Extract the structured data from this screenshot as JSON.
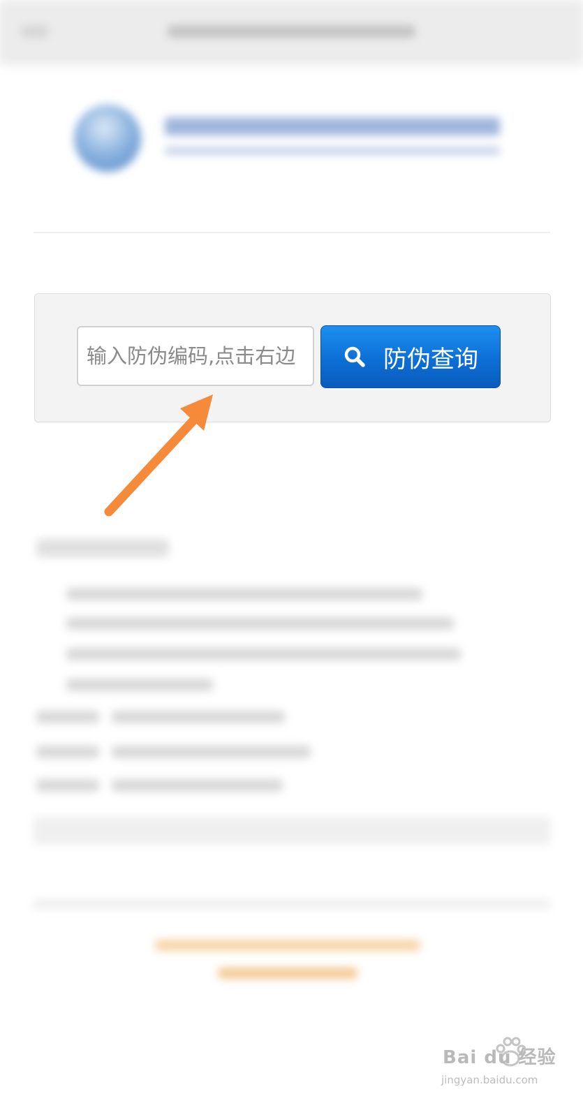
{
  "search": {
    "placeholder": "输入防伪编码,点击右边",
    "button_label": "防伪查询"
  },
  "watermark": {
    "brand": "Bai du 经验",
    "url": "jingyan.baidu.com"
  },
  "colors": {
    "button": "#0c6fd6",
    "arrow": "#f48a3a"
  },
  "icons": {
    "search": "magnifier-icon",
    "annotation": "arrow-icon",
    "watermark": "paw-icon"
  }
}
